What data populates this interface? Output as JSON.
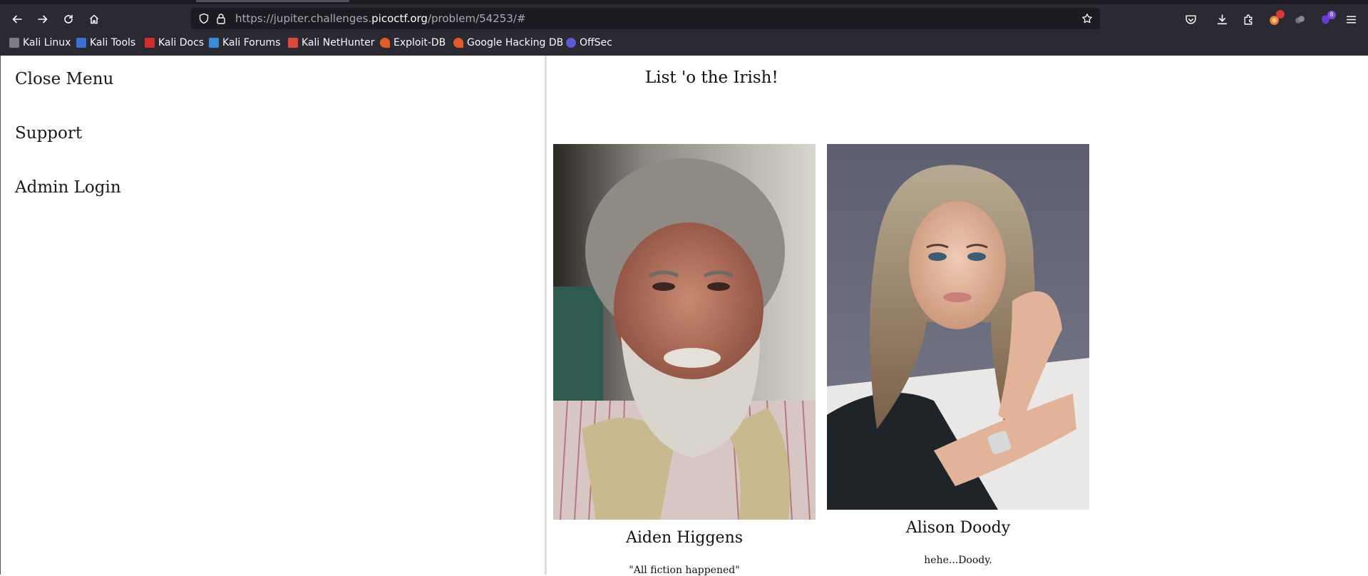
{
  "browser": {
    "url_prefix": "https://jupiter.challenges.",
    "url_host": "picoctf.org",
    "url_path": "/problem/54253/#",
    "extension_badge": "8",
    "bookmarks": [
      {
        "label": "Kali Linux",
        "icon": "kali-dragon-icon",
        "color": "#7b7b88"
      },
      {
        "label": "Kali Tools",
        "icon": "kali-tools-icon",
        "color": "#3b6fd6"
      },
      {
        "label": "Kali Docs",
        "icon": "kali-docs-icon",
        "color": "#d12f2f"
      },
      {
        "label": "Kali Forums",
        "icon": "kali-forums-icon",
        "color": "#3a8ad8"
      },
      {
        "label": "Kali NetHunter",
        "icon": "nethunter-icon",
        "color": "#d94a3a"
      },
      {
        "label": "Exploit-DB",
        "icon": "exploit-db-icon",
        "color": "#e2592b"
      },
      {
        "label": "Google Hacking DB",
        "icon": "ghdb-icon",
        "color": "#e2592b"
      },
      {
        "label": "OffSec",
        "icon": "offsec-icon",
        "color": "#5b5bd6"
      }
    ]
  },
  "sidenav": {
    "close": "Close Menu",
    "support": "Support",
    "admin": "Admin Login"
  },
  "main": {
    "title": "List 'o the Irish!",
    "people": [
      {
        "name": "Aiden Higgens",
        "quote": "\"All fiction happened\""
      },
      {
        "name": "Alison Doody",
        "quote": "hehe...Doody."
      }
    ]
  }
}
